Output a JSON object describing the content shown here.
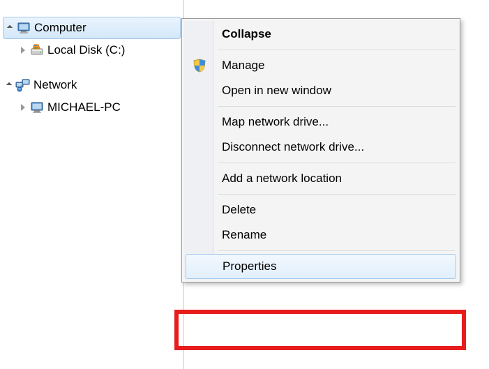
{
  "tree": {
    "computer": "Computer",
    "local_disk": "Local Disk (C:)",
    "network": "Network",
    "pc_name": "MICHAEL-PC"
  },
  "menu": {
    "collapse": "Collapse",
    "manage": "Manage",
    "open_new_window": "Open in new window",
    "map_drive": "Map network drive...",
    "disconnect_drive": "Disconnect network drive...",
    "add_location": "Add a network location",
    "delete": "Delete",
    "rename": "Rename",
    "properties": "Properties"
  }
}
